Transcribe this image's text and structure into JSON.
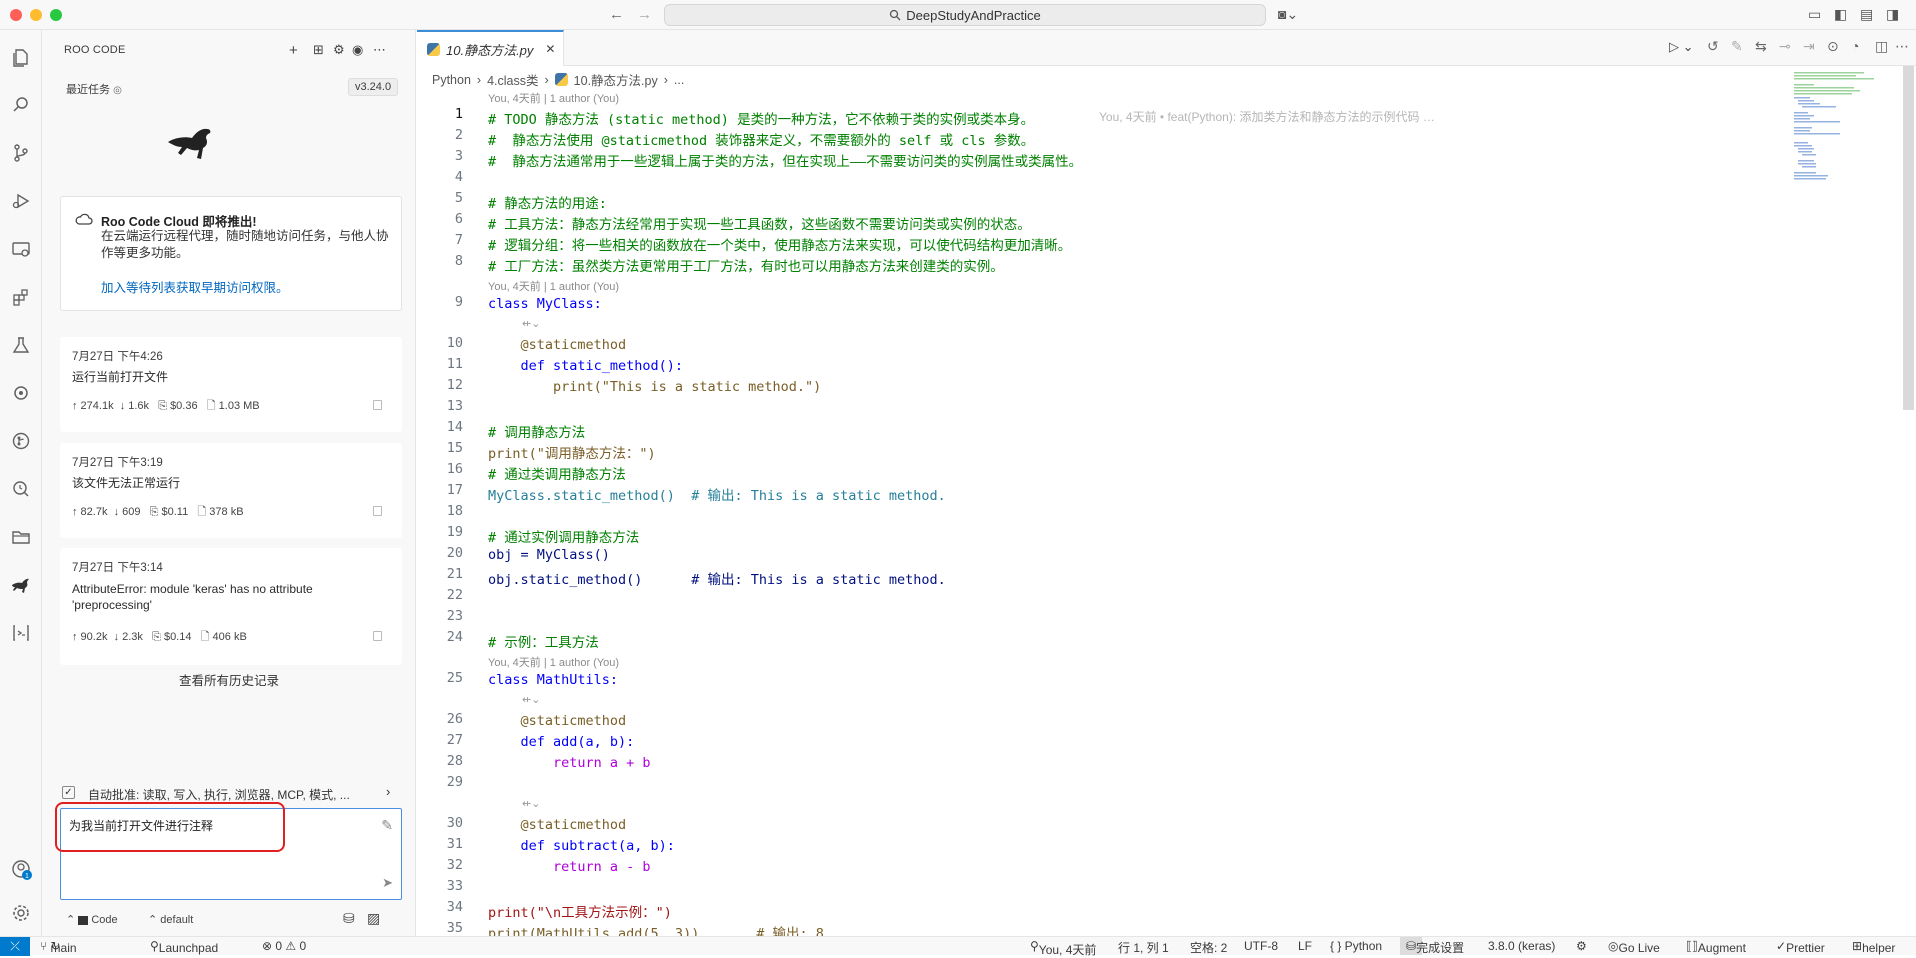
{
  "titlebar": {
    "command_center": "DeepStudyAndPractice"
  },
  "sidebar": {
    "title": "ROO CODE",
    "recent_label": "最近任务",
    "version": "v3.24.0",
    "cloud": {
      "title": "Roo Code Cloud 即将推出!",
      "desc": "在云端运行远程代理，随时随地访问任务，与他人协作等更多功能。",
      "link": "加入等待列表获取早期访问权限。"
    },
    "tasks": [
      {
        "date": "7月27日 下午4:26",
        "title": "运行当前打开文件",
        "meta": "↑ 274.1k  ↓ 1.6k   ⎘ $0.36   🗋 1.03 MB"
      },
      {
        "date": "7月27日 下午3:19",
        "title": "该文件无法正常运行",
        "meta": "↑ 82.7k  ↓ 609   ⎘ $0.11   🗋 378 kB"
      },
      {
        "date": "7月27日 下午3:14",
        "title": "AttributeError: module 'keras' has no attribute 'preprocessing'",
        "meta": "↑ 90.2k  ↓ 2.3k   ⎘ $0.14   🗋 406 kB"
      }
    ],
    "history_link": "查看所有历史记录",
    "auto_approve": "自动批准: 读取, 写入, 执行, 浏览器, MCP, 模式, ...",
    "chat_input": "为我当前打开文件进行注释",
    "mode": "Code",
    "profile": "default"
  },
  "editor": {
    "tab_label": "10.静态方法.py",
    "breadcrumb": [
      "Python",
      "4.class类",
      "10.静态方法.py",
      "..."
    ],
    "blame": "You, 4天前 | 1 author (You)",
    "inline_blame": "You, 4天前 • feat(Python): 添加类方法和静态方法的示例代码 …",
    "lines": [
      "# TODO 静态方法 (static method) 是类的一种方法，它不依赖于类的实例或类本身。",
      "#  静态方法使用 @staticmethod 装饰器来定义，不需要额外的 self 或 cls 参数。",
      "#  静态方法通常用于一些逻辑上属于类的方法，但在实现上——不需要访问类的实例属性或类属性。",
      "",
      "# 静态方法的用途:",
      "# 工具方法：静态方法经常用于实现一些工具函数，这些函数不需要访问类或实例的状态。",
      "# 逻辑分组：将一些相关的函数放在一个类中，使用静态方法来实现，可以使代码结构更加清晰。",
      "# 工厂方法：虽然类方法更常用于工厂方法，有时也可以用静态方法来创建类的实例。",
      "class MyClass:",
      "    @staticmethod",
      "    def static_method():",
      "        print(\"This is a static method.\")",
      "",
      "# 调用静态方法",
      "print(\"调用静态方法：\")",
      "# 通过类调用静态方法",
      "MyClass.static_method()  # 输出: This is a static method.",
      "",
      "# 通过实例调用静态方法",
      "obj = MyClass()",
      "obj.static_method()      # 输出: This is a static method.",
      "",
      "",
      "# 示例：工具方法",
      "class MathUtils:",
      "    @staticmethod",
      "    def add(a, b):",
      "        return a + b",
      "",
      "    @staticmethod",
      "    def subtract(a, b):",
      "        return a - b",
      "",
      "print(\"\\n工具方法示例：\")",
      "print(MathUtils.add(5, 3))       # 输出: 8"
    ]
  },
  "status": {
    "branch": "main",
    "launchpad": "Launchpad",
    "problems": "⊗ 0 ⚠ 0",
    "blame": "You, 4天前",
    "position": "行 1, 列 1",
    "spaces": "空格: 2",
    "encoding": "UTF-8",
    "eol": "LF",
    "language": "{ } Python",
    "setup": "完成设置",
    "interpreter": "3.8.0 (keras)",
    "golive": "Go Live",
    "augment": "Augment",
    "prettier": "Prettier",
    "helper": "helper"
  }
}
